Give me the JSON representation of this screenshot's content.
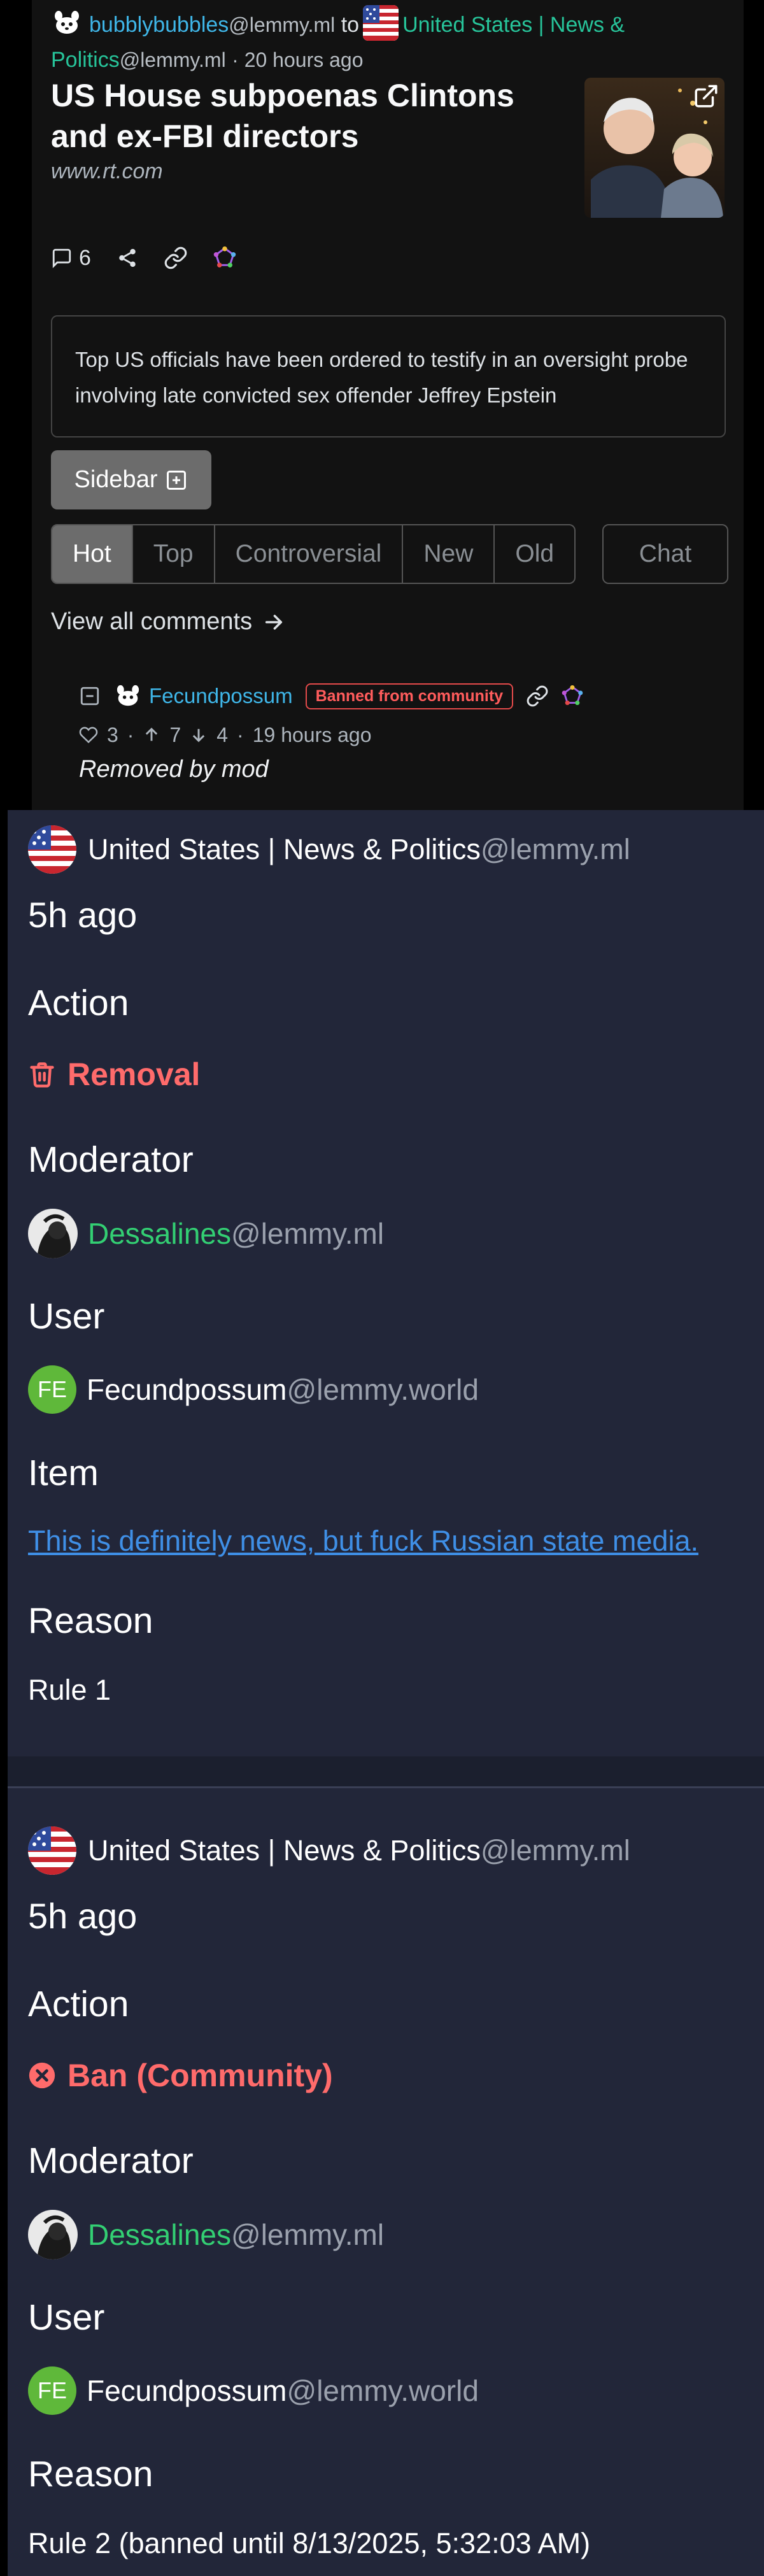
{
  "post": {
    "creator_name": "bubblybubbles",
    "creator_instance": "@lemmy.ml",
    "to_word": "to",
    "community_name": "United States | News & Politics",
    "community_instance": "@lemmy.ml",
    "time_ago": "· 20 hours ago",
    "title": "US House subpoenas Clintons and ex-FBI directors",
    "url_domain": "www.rt.com",
    "comment_count": "6",
    "body": "Top US officials have been ordered to testify in an oversight probe involving late convicted sex offender Jeffrey Epstein",
    "sidebar_label": "Sidebar",
    "sort_options": [
      "Hot",
      "Top",
      "Controversial",
      "New",
      "Old"
    ],
    "chat_label": "Chat",
    "view_all_label": "View all comments"
  },
  "comment": {
    "commenter": "Fecundpossum",
    "banned_badge": "Banned from community",
    "score": "3",
    "upvotes": "7",
    "downvotes": "4",
    "time_ago": "19 hours ago",
    "dot": "·",
    "content": "Removed by mod"
  },
  "modlog": [
    {
      "community_name": "United States | News & Politics",
      "community_instance": "@lemmy.ml",
      "time": "5h ago",
      "action_heading": "Action",
      "action": "Removal",
      "moderator_heading": "Moderator",
      "moderator_name": "Dessalines",
      "moderator_instance": "@lemmy.ml",
      "user_heading": "User",
      "user_initials": "FE",
      "user_name": "Fecundpossum",
      "user_instance": "@lemmy.world",
      "item_heading": "Item",
      "item_text": "This is definitely news, but fuck Russian state media.",
      "reason_heading": "Reason",
      "reason": "Rule 1"
    },
    {
      "community_name": "United States | News & Politics",
      "community_instance": "@lemmy.ml",
      "time": "5h ago",
      "action_heading": "Action",
      "action": "Ban (Community)",
      "moderator_heading": "Moderator",
      "moderator_name": "Dessalines",
      "moderator_instance": "@lemmy.ml",
      "user_heading": "User",
      "user_initials": "FE",
      "user_name": "Fecundpossum",
      "user_instance": "@lemmy.world",
      "reason_heading": "Reason",
      "reason": "Rule 2 (banned until 8/13/2025, 5:32:03 AM)"
    }
  ],
  "colors": {
    "creator": "#3fb6e8",
    "community": "#27c49a",
    "moderator": "#33cf73",
    "removal": "#ff6b6b",
    "link": "#3f8fe6",
    "card_bg": "#222639"
  },
  "icons": [
    "bunny-avatar-icon",
    "us-flag-icon",
    "external-link-icon",
    "comment-icon",
    "share-icon",
    "link-icon",
    "fediverse-icon",
    "plus-square-icon",
    "arrow-right-icon",
    "collapse-icon",
    "heart-icon",
    "arrow-up-icon",
    "arrow-down-icon",
    "trash-icon",
    "x-circle-icon"
  ]
}
